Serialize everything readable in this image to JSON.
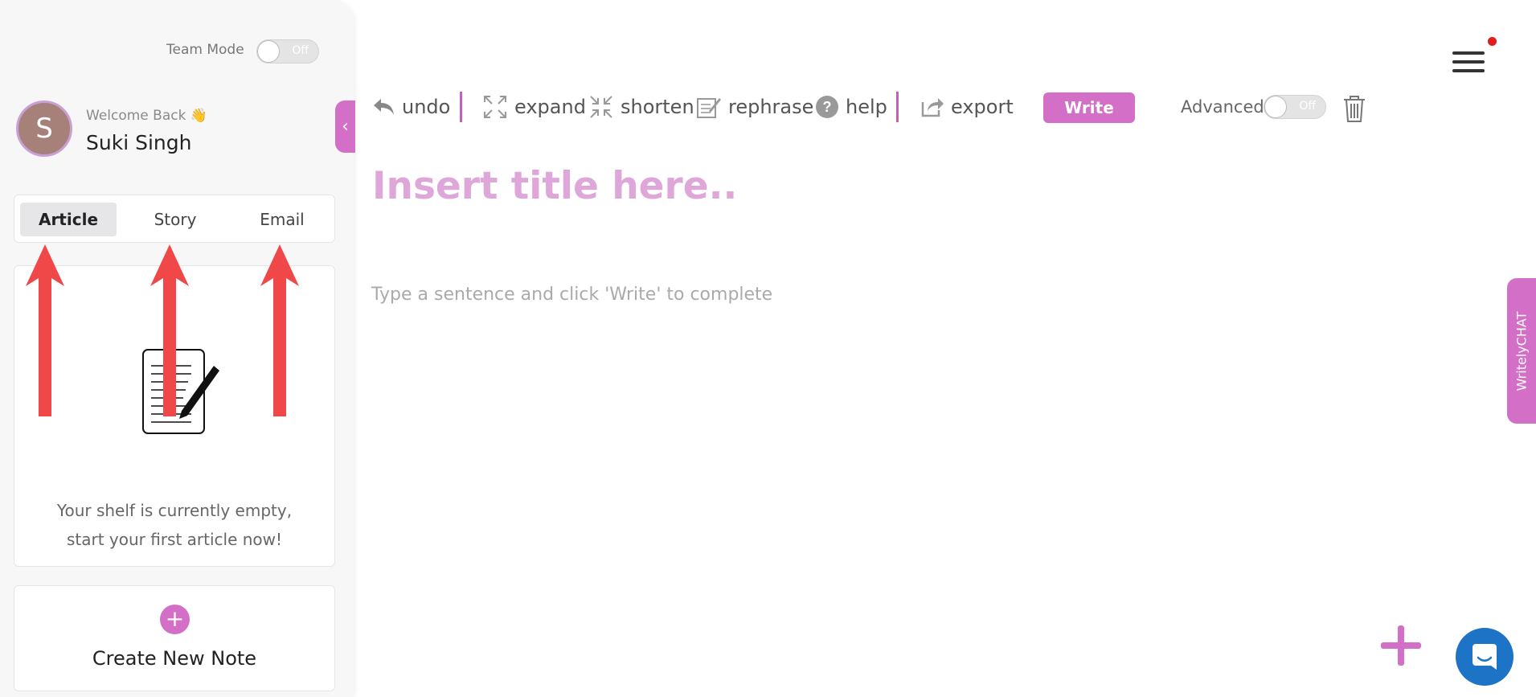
{
  "sidebar": {
    "team_mode_label": "Team Mode",
    "team_mode_state": "Off",
    "avatar_initial": "S",
    "welcome_text": "Welcome Back 👋",
    "username": "Suki Singh",
    "tabs": [
      {
        "label": "Article",
        "active": true
      },
      {
        "label": "Story",
        "active": false
      },
      {
        "label": "Email",
        "active": false
      }
    ],
    "shelf_line1": "Your shelf is currently empty,",
    "shelf_line2": "start your first article now!",
    "create_label": "Create New Note"
  },
  "toolbar": {
    "undo": "undo",
    "expand": "expand",
    "shorten": "shorten",
    "rephrase": "rephrase",
    "help": "help",
    "export": "export",
    "write": "Write",
    "advanced_label": "Advanced",
    "advanced_state": "Off"
  },
  "editor": {
    "title_placeholder": "Insert title here..",
    "body_placeholder": "Type a sentence and click 'Write' to complete"
  },
  "chat_tab_label": "WritelyCHAT",
  "colors": {
    "accent": "#d46fc7",
    "annotation_arrow": "#f04848",
    "messenger": "#1d73c6"
  }
}
